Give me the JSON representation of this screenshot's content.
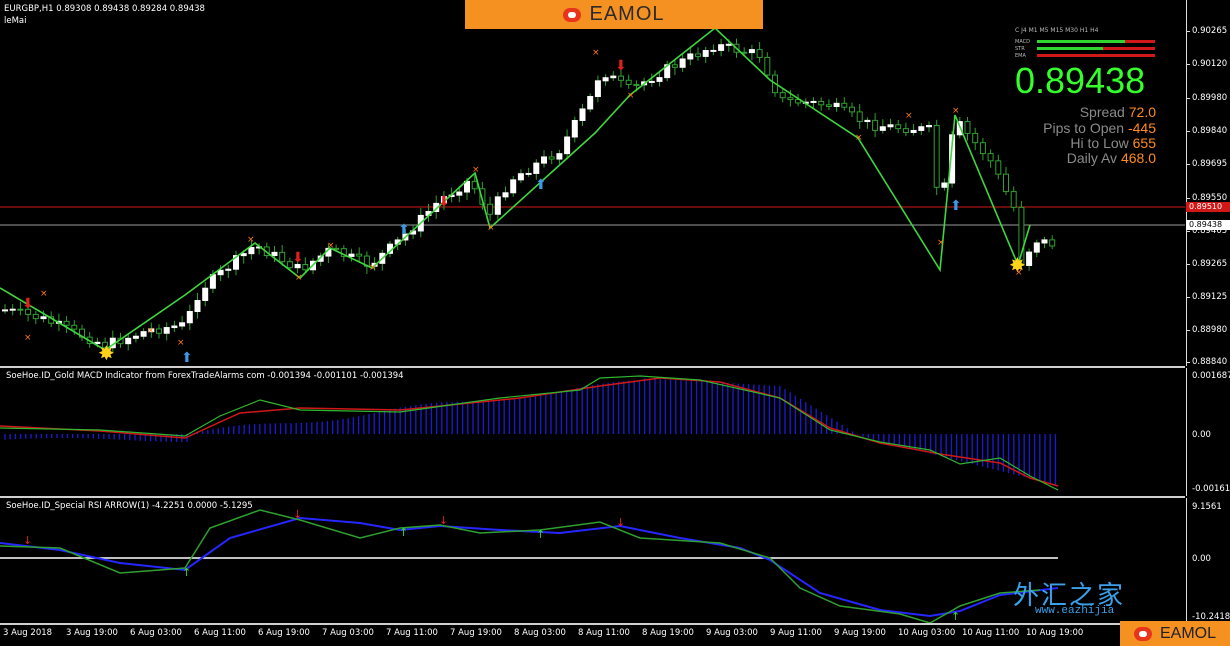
{
  "chart": {
    "symbol_header": "EURGBP,H1  0.89308 0.89438 0.89284 0.89438",
    "indicator_label": "leMai",
    "macd_label": "SoeHoe.ID_Gold MACD Indicator from ForexTradeAlarms com -0.001394 -0.001101 -0.001394",
    "rsi_label": "SoeHoe.ID_Special RSI ARROW(1) -4.2251 0.0000 -5.1295",
    "price_axis": [
      "0.90265",
      "0.90120",
      "0.89980",
      "0.89840",
      "0.89695",
      "0.89550",
      "0.89405",
      "0.89265",
      "0.89125",
      "0.88980",
      "0.88840"
    ],
    "red_line_label": "0.89510",
    "bid_label": "0.89438",
    "macd_axis": [
      "0.001687",
      "0.00",
      "-0.001611"
    ],
    "rsi_axis": [
      "9.1561",
      "0.00",
      "-10.2418"
    ],
    "time_axis": [
      "3 Aug 2018",
      "3 Aug 19:00",
      "6 Aug 03:00",
      "6 Aug 11:00",
      "6 Aug 19:00",
      "7 Aug 03:00",
      "7 Aug 11:00",
      "7 Aug 19:00",
      "8 Aug 03:00",
      "8 Aug 11:00",
      "8 Aug 19:00",
      "9 Aug 03:00",
      "9 Aug 11:00",
      "9 Aug 19:00",
      "10 Aug 03:00",
      "10 Aug 11:00",
      "10 Aug 19:00"
    ],
    "colors": {
      "background": "#000000",
      "candle_up": "#ffffff",
      "candle_down": "#2fa02f",
      "zigzag": "#3fd63f",
      "macd_signal": "#d01818",
      "macd_line": "#2fb82f",
      "macd_hist": "#1a1acf",
      "rsi_blue": "#2626ff",
      "rsi_green": "#2fa02f",
      "red_level": "#d01818"
    }
  },
  "banner": {
    "brand": "EAMOL"
  },
  "panel": {
    "price": "0.89438",
    "spread_label": "Spread",
    "spread_value": "72.0",
    "pips_label": "Pips to Open",
    "pips_value": "-445",
    "hilo_label": "Hi to Low",
    "hilo_value": "655",
    "daily_label": "Daily Av",
    "daily_value": "468.0",
    "tf_row": "C  J4     M1   M5  M15 M30  H1   H4",
    "tf_names": [
      "MACD",
      "STR",
      "EMA"
    ]
  },
  "footer": {
    "brand": "EAMOL"
  },
  "watermark": {
    "text": "外汇之家",
    "url": "www.eazhijia"
  }
}
